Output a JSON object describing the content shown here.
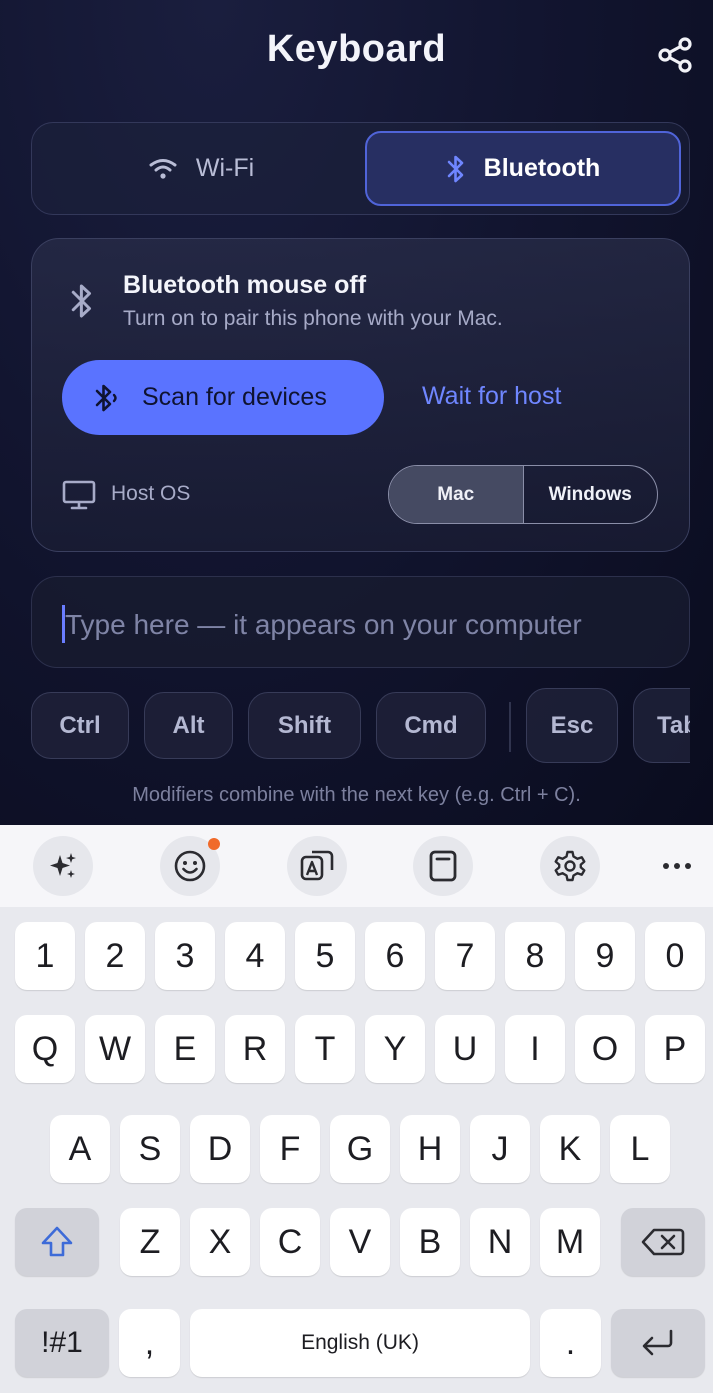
{
  "header": {
    "title": "Keyboard",
    "share_icon": "share-icon"
  },
  "connection": {
    "options": [
      {
        "label": "Wi-Fi",
        "icon": "wifi-icon",
        "selected": false
      },
      {
        "label": "Bluetooth",
        "icon": "bluetooth-icon",
        "selected": true
      }
    ]
  },
  "bluetooth_card": {
    "status_title": "Bluetooth mouse off",
    "status_subtitle": "Turn on to pair this phone with your Mac.",
    "scan_button": "Scan for devices",
    "wait_link": "Wait for host",
    "host_os_label": "Host OS",
    "os_options": [
      {
        "label": "Mac",
        "selected": true
      },
      {
        "label": "Windows",
        "selected": false
      }
    ]
  },
  "type_input": {
    "placeholder": "Type here — it appears on your computer",
    "value": ""
  },
  "modifiers": {
    "keys": [
      "Ctrl",
      "Alt",
      "Shift",
      "Cmd"
    ],
    "special": [
      "Esc",
      "Tab"
    ],
    "hint": "Modifiers combine with the next key (e.g. Ctrl + C)."
  },
  "keyboard": {
    "toolbar": [
      "sparkle-icon",
      "emoji-icon",
      "translate-icon",
      "clipboard-icon",
      "settings-icon",
      "more-icon"
    ],
    "row_numbers": [
      "1",
      "2",
      "3",
      "4",
      "5",
      "6",
      "7",
      "8",
      "9",
      "0"
    ],
    "row_top": [
      "Q",
      "W",
      "E",
      "R",
      "T",
      "Y",
      "U",
      "I",
      "O",
      "P"
    ],
    "row_middle": [
      "A",
      "S",
      "D",
      "F",
      "G",
      "H",
      "J",
      "K",
      "L"
    ],
    "row_bottom": [
      "Z",
      "X",
      "C",
      "V",
      "B",
      "N",
      "M"
    ],
    "symbols_key": "!#1",
    "comma_key": ",",
    "space_label": "English (UK)",
    "period_key": "."
  },
  "colors": {
    "accent": "#5a73ff",
    "link": "#6f86ff",
    "background": "#0c0f24",
    "notification_dot": "#f06a2a"
  }
}
